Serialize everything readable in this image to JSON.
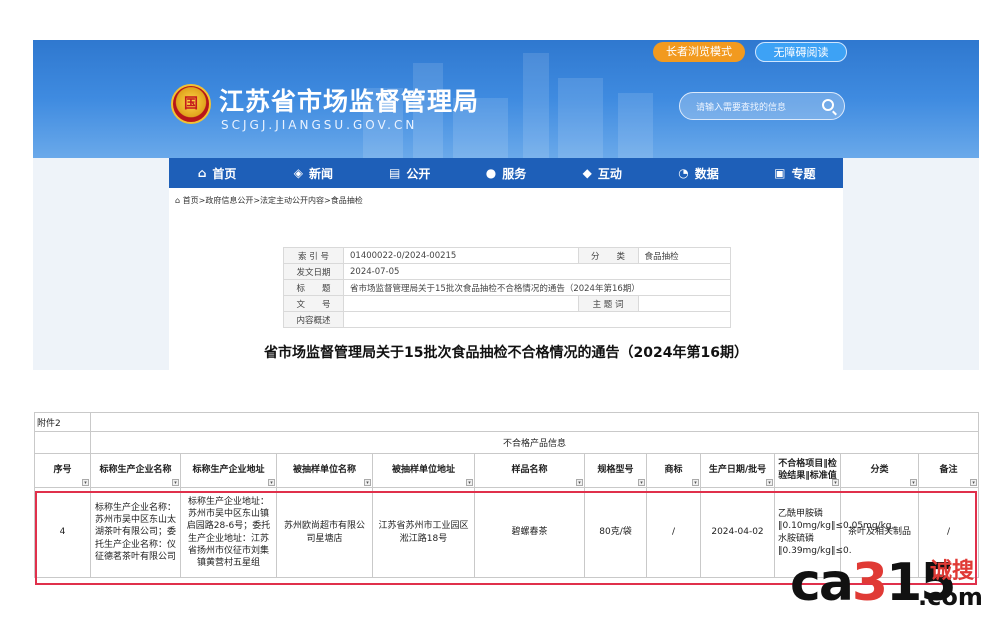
{
  "header": {
    "title": "江苏省市场监督管理局",
    "domain": "SCJGJ.JIANGSU.GOV.CN",
    "elder_mode": "长者浏览模式",
    "accessible_mode": "无障碍阅读",
    "search_placeholder": "请输入需要查找的信息",
    "emblem_char": "国"
  },
  "nav": [
    {
      "label": "首页",
      "icon": "home-icon",
      "glyph": "⌂"
    },
    {
      "label": "新闻",
      "icon": "layers-icon",
      "glyph": "◈"
    },
    {
      "label": "公开",
      "icon": "document-icon",
      "glyph": "▤"
    },
    {
      "label": "服务",
      "icon": "user-icon",
      "glyph": "●"
    },
    {
      "label": "互动",
      "icon": "handshake-icon",
      "glyph": "◆"
    },
    {
      "label": "数据",
      "icon": "pie-chart-icon",
      "glyph": "◔"
    },
    {
      "label": "专题",
      "icon": "topic-icon",
      "glyph": "▣"
    }
  ],
  "breadcrumb": "⌂ 首页>政府信息公开>法定主动公开内容>食品抽检",
  "meta": {
    "index_label": "索 引 号",
    "index_value": "01400022-0/2024-00215",
    "category_label": "分　　类",
    "category_value": "食品抽检",
    "date_label": "发文日期",
    "date_value": "2024-07-05",
    "title_label": "标　　题",
    "title_value": "省市场监督管理局关于15批次食品抽检不合格情况的通告（2024年第16期）",
    "doc_label": "文　　号",
    "doc_value": "",
    "topic_label": "主 题 词",
    "topic_value": "",
    "summary_label": "内容概述",
    "summary_value": ""
  },
  "notice_title": "省市场监督管理局关于15批次食品抽检不合格情况的通告（2024年第16期）",
  "sheet": {
    "attachment": "附件2",
    "group_header": "不合格产品信息",
    "columns": [
      "序号",
      "标称生产企业名称",
      "标称生产企业地址",
      "被抽样单位名称",
      "被抽样单位地址",
      "样品名称",
      "规格型号",
      "商标",
      "生产日期/批号",
      "不合格项目‖检验结果‖标准值",
      "分类",
      "备注"
    ],
    "row": {
      "no": "4",
      "company": "标称生产企业名称：苏州市吴中区东山太湖茶叶有限公司；委托生产企业名称：仪征德茗茶叶有限公司",
      "address": "标称生产企业地址：苏州市吴中区东山镇启园路28-6号；委托生产企业地址：江苏省扬州市仪征市刘集镇黄营村五星组",
      "sampled_unit": "苏州欧尚超市有限公司星塘店",
      "sampled_address": "江苏省苏州市工业园区淞江路18号",
      "sample": "碧螺春茶",
      "spec": "80克/袋",
      "brand": "/",
      "date": "2024-04-02",
      "result": "乙酰甲胺磷‖0.10mg/kg‖≤0.05mg/kg,水胺硫磷‖0.39mg/kg‖≤0.",
      "category": "茶叶及相关制品",
      "remark": "/"
    }
  },
  "watermark": {
    "ca": "ca",
    "r": "3",
    "s": "15",
    "cn": "诚搜",
    "com": ".com"
  }
}
